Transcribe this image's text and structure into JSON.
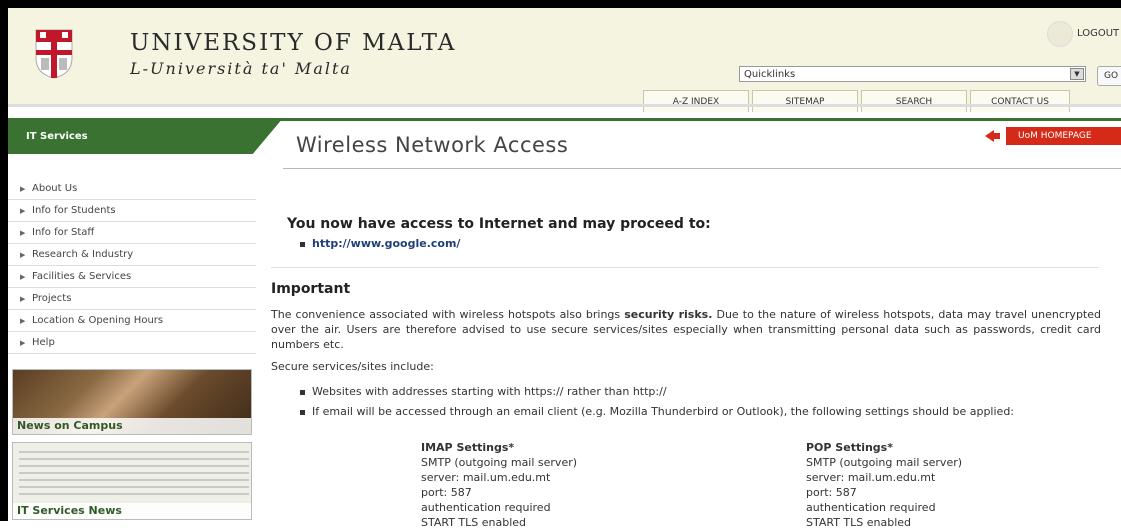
{
  "header": {
    "university_name": "UNIVERSITY OF MALTA",
    "university_subtitle": "L-Università ta' Malta",
    "logout_label": "LOGOUT",
    "quicklinks_value": "Quicklinks",
    "go_label": "GO",
    "nav": [
      "A-Z INDEX",
      "SITEMAP",
      "SEARCH",
      "CONTACT US"
    ]
  },
  "section": {
    "label": "IT Services",
    "page_title": "Wireless Network Access",
    "uom_home_label": "UoM HOMEPAGE"
  },
  "sidebar": {
    "items": [
      "About Us",
      "Info for Students",
      "Info for Staff",
      "Research & Industry",
      "Facilities & Services",
      "Projects",
      "Location & Opening Hours",
      "Help"
    ],
    "promo1_caption": "News on Campus",
    "promo2_caption": "IT Services News"
  },
  "content": {
    "access_heading": "You now have access to Internet and may proceed to:",
    "google_link": "http://www.google.com/",
    "important_heading": "Important",
    "paragraph_start": "The convenience associated with wireless hotspots also brings ",
    "paragraph_bold": "security risks.",
    "paragraph_end": " Due to the nature of wireless hotspots, data may travel unencrypted over the air. Users are therefore advised to use secure services/sites especially when transmitting personal data such as passwords, credit card numbers etc.",
    "secure_label": "Secure services/sites include:",
    "bullet1": "Websites with addresses starting with https:// rather than http://",
    "bullet2": "If email will be accessed through an email client (e.g. Mozilla Thunderbird or Outlook), the following settings should be applied:",
    "imap": {
      "heading": "IMAP Settings*",
      "lines": [
        "SMTP (outgoing mail server)",
        "server: mail.um.edu.mt",
        "port: 587",
        "authentication required",
        "START TLS enabled"
      ]
    },
    "pop": {
      "heading": "POP Settings*",
      "lines": [
        "SMTP (outgoing mail server)",
        "server: mail.um.edu.mt",
        "port: 587",
        "authentication required",
        "START TLS enabled"
      ]
    }
  },
  "colors": {
    "green": "#3a7232",
    "red": "#d52a17",
    "header_bg": "#f4f4e1",
    "link": "#1f3f7a"
  }
}
